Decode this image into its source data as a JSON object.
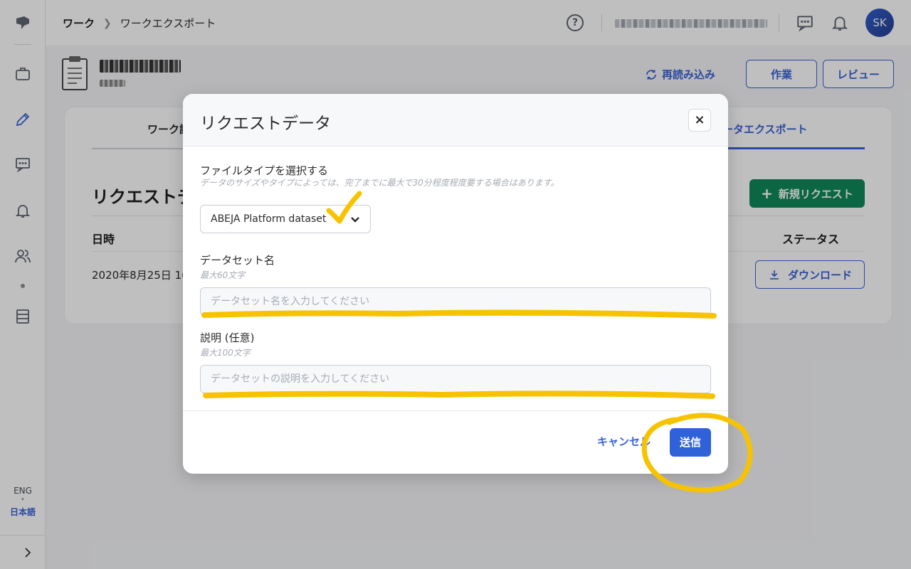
{
  "sidebar": {
    "items": [
      "logo-icon",
      "briefcase-icon",
      "pencil-icon",
      "chat-icon",
      "bell-icon",
      "users-icon",
      "storage-icon"
    ],
    "active": "pencil-icon",
    "lang_eng": "ENG",
    "lang_dot": "•",
    "lang_ja": "日本語"
  },
  "topbar": {
    "breadcrumb_root": "ワーク",
    "breadcrumb_current": "ワークエクスポート",
    "help_label": "?",
    "avatar_initials": "SK"
  },
  "header": {
    "reload_label": "再読み込み",
    "work_button": "作業",
    "review_button": "レビュー"
  },
  "card": {
    "tab_left": "ワーク詳",
    "tab_right": "ータエクスポート",
    "section_title": "リクエストデ",
    "new_request_label": "新規リクエスト",
    "col_date": "日時",
    "col_status": "ステータス",
    "row_date": "2020年8月25日 16",
    "download_label": "ダウンロード"
  },
  "modal": {
    "title": "リクエストデータ",
    "close_label": "×",
    "filetype_label": "ファイルタイプを選択する",
    "filetype_hint": "データのサイズやタイプによっては、完了までに最大で30分程度程度要する場合はあります。",
    "filetype_value": "ABEJA Platform dataset",
    "name_label": "データセット名",
    "name_hint": "最大60文字",
    "name_placeholder": "データセット名を入力してください",
    "desc_label": "説明 (任意)",
    "desc_hint": "最大100文字",
    "desc_placeholder": "データセットの説明を入力してください",
    "cancel_label": "キャンセル",
    "submit_label": "送信"
  },
  "colors": {
    "accent": "#3a63d8",
    "success": "#0f8a5a",
    "annotation": "#f7c300"
  }
}
